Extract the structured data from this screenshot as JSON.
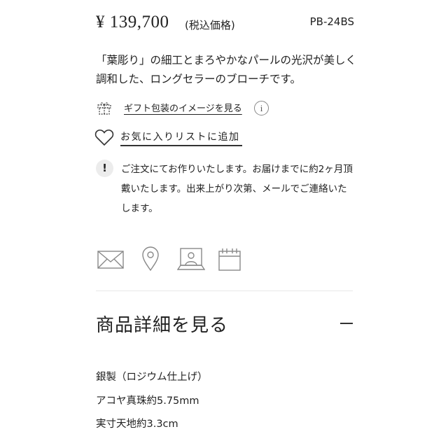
{
  "product": {
    "price": "¥ 139,700",
    "tax_note": "(税込価格)",
    "code": "PB-24BS",
    "description": "「葉彫り」の細工とまろやかなパールの光沢が美しく調和した、ロングセラーのブローチです。"
  },
  "actions": {
    "gift_wrap_link": "ギフト包装のイメージを見る",
    "info_icon_glyph": "i",
    "favorite_link": "お気に入りリストに追加"
  },
  "notice": {
    "icon_glyph": "!",
    "text": "ご注文にてお作りいたします。お届けまでに約2ヶ月頂戴いたします。出来上がり次第、メールでご連絡いたします。"
  },
  "contact_icons": [
    "mail-icon",
    "location-pin-icon",
    "video-consultation-icon",
    "calendar-icon"
  ],
  "details": {
    "title": "商品詳細を見る",
    "specs": [
      "銀製（ロジウム仕上げ）",
      "アコヤ真珠約5.75mm",
      "実寸天地約3.3cm"
    ]
  }
}
